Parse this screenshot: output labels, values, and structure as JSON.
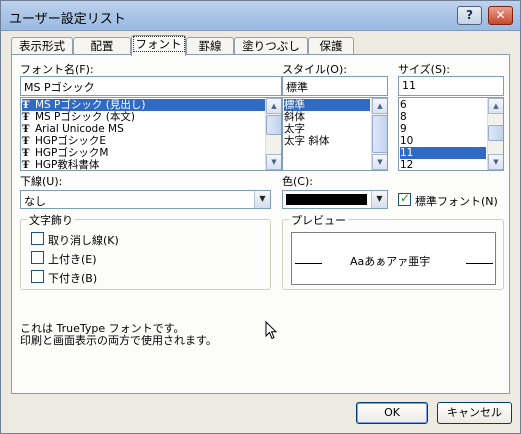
{
  "window": {
    "title": "ユーザー設定リスト",
    "help_label": "?",
    "close_label": "✕"
  },
  "tabs": [
    {
      "label": "表示形式"
    },
    {
      "label": "配置"
    },
    {
      "label": "フォント",
      "active": true
    },
    {
      "label": "罫線"
    },
    {
      "label": "塗りつぶし"
    },
    {
      "label": "保護"
    }
  ],
  "font": {
    "label": "フォント名(F):",
    "value": "MS Pゴシック",
    "items": [
      {
        "label": "MS Pゴシック (見出し)",
        "icon": "truetype-icon",
        "selected": true
      },
      {
        "label": "MS Pゴシック (本文)",
        "icon": "truetype-icon"
      },
      {
        "label": "Arial Unicode MS",
        "icon": "truetype-icon"
      },
      {
        "label": "HGPゴシックE",
        "icon": "truetype-icon"
      },
      {
        "label": "HGPゴシックM",
        "icon": "truetype-icon"
      },
      {
        "label": "HGP教科書体",
        "icon": "truetype-icon"
      }
    ]
  },
  "style": {
    "label": "スタイル(O):",
    "value": "標準",
    "items": [
      {
        "label": "標準",
        "selected": true
      },
      {
        "label": "斜体"
      },
      {
        "label": "太字"
      },
      {
        "label": "太字 斜体"
      }
    ]
  },
  "size": {
    "label": "サイズ(S):",
    "value": "11",
    "items": [
      {
        "label": "6"
      },
      {
        "label": "8"
      },
      {
        "label": "9"
      },
      {
        "label": "10"
      },
      {
        "label": "11",
        "selected": true
      },
      {
        "label": "12"
      }
    ]
  },
  "underline": {
    "label": "下線(U):",
    "value": "なし"
  },
  "color": {
    "label": "色(C):",
    "swatch": "#000000"
  },
  "normal_font": {
    "label": "標準フォント(N)",
    "checked": true
  },
  "effects": {
    "title": "文字飾り",
    "items": [
      {
        "label": "取り消し線(K)",
        "checked": false
      },
      {
        "label": "上付き(E)",
        "checked": false
      },
      {
        "label": "下付き(B)",
        "checked": false
      }
    ]
  },
  "preview": {
    "title": "プレビュー",
    "text": "Aaあぁアァ亜宇"
  },
  "description": {
    "line1": "これは TrueType フォントです。",
    "line2": "印刷と画面表示の両方で使用されます。"
  },
  "buttons": {
    "ok": "OK",
    "cancel": "キャンセル"
  },
  "colors": {
    "selection": "#316ac5",
    "titlebar": "#a8c3e6"
  }
}
